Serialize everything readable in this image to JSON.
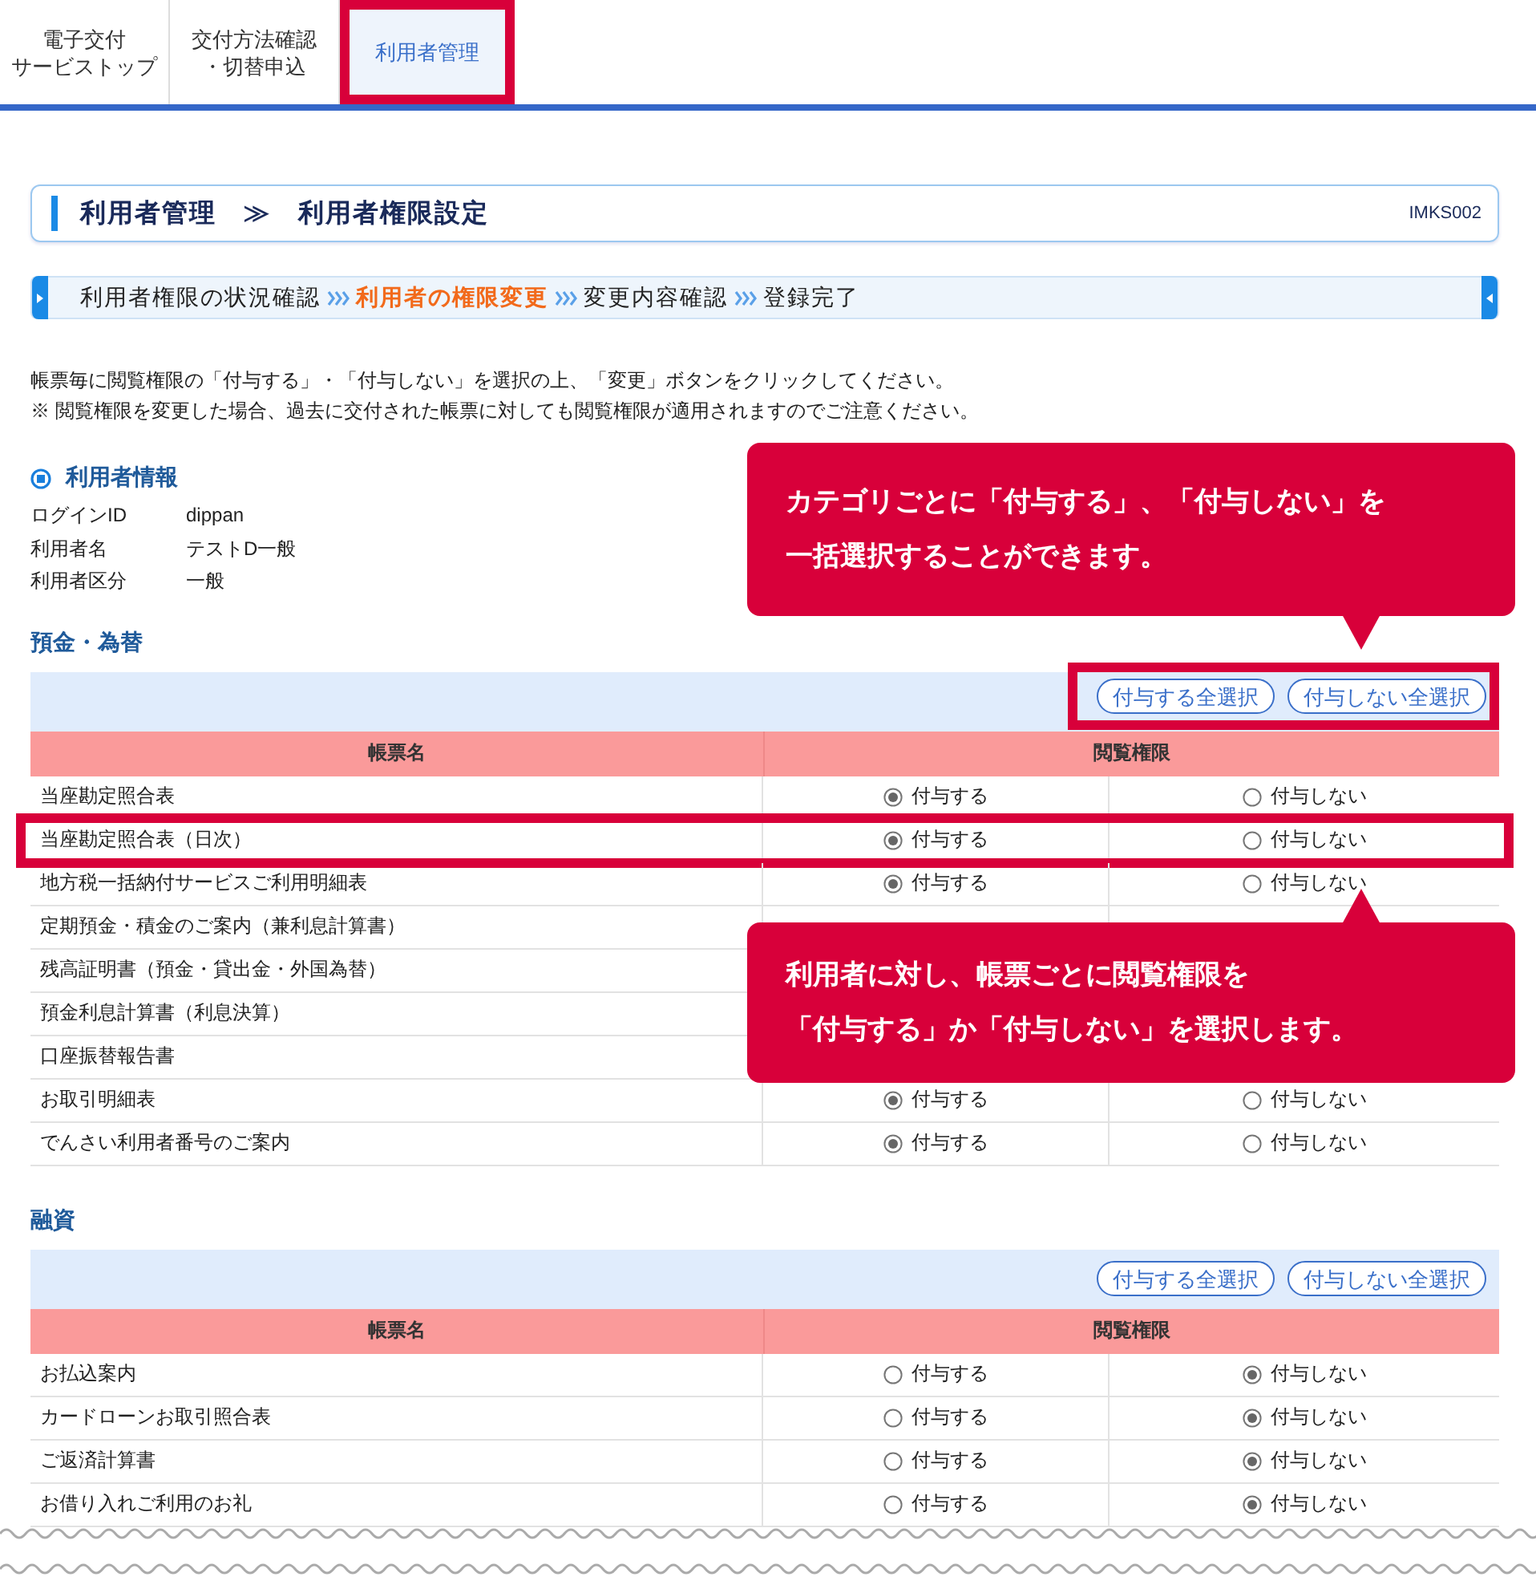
{
  "tabs": [
    {
      "lines": [
        "電子交付",
        "サービストップ"
      ],
      "selected": false,
      "highlighted": false
    },
    {
      "lines": [
        "交付方法確認",
        "・切替申込"
      ],
      "selected": false,
      "highlighted": false
    },
    {
      "lines": [
        "利用者管理"
      ],
      "selected": true,
      "highlighted": true
    }
  ],
  "page_title": {
    "text": "利用者管理　≫　利用者権限設定",
    "screen_id": "IMKS002"
  },
  "steps": [
    {
      "label": "利用者権限の状況確認",
      "current": false
    },
    {
      "label": "利用者の権限変更",
      "current": true
    },
    {
      "label": "変更内容確認",
      "current": false
    },
    {
      "label": "登録完了",
      "current": false
    }
  ],
  "instructions": [
    "帳票毎に閲覧権限の「付与する」・「付与しない」を選択の上、「変更」ボタンをクリックしてください。",
    "※ 閲覧権限を変更した場合、過去に交付された帳票に対しても閲覧権限が適用されますのでご注意ください。"
  ],
  "user_info": {
    "heading": "利用者情報",
    "fields": [
      {
        "label": "ログインID",
        "value": "dippan"
      },
      {
        "label": "利用者名",
        "value": "テストD一般"
      },
      {
        "label": "利用者区分",
        "value": "一般"
      }
    ]
  },
  "sections": [
    {
      "title": "預金・為替",
      "buttons": [
        "付与する全選択",
        "付与しない全選択"
      ],
      "buttons_highlighted": true,
      "columns": [
        "帳票名",
        "閲覧権限"
      ],
      "callouts": [
        {
          "kind": "above",
          "lines": [
            "カテゴリごとに「付与する」、「付与しない」を",
            "一括選択することができます。"
          ]
        },
        {
          "kind": "over_rows",
          "lines": [
            "利用者に対し、帳票ごとに閲覧権限を",
            "「付与する」か「付与しない」を選択します。"
          ]
        }
      ],
      "rows": [
        {
          "name": "当座勘定照合表",
          "highlighted": false,
          "options": [
            {
              "label": "付与する",
              "selected": true
            },
            {
              "label": "付与しない",
              "selected": false
            }
          ]
        },
        {
          "name": "当座勘定照合表（日次）",
          "highlighted": true,
          "options": [
            {
              "label": "付与する",
              "selected": true
            },
            {
              "label": "付与しない",
              "selected": false
            }
          ]
        },
        {
          "name": "地方税一括納付サービスご利用明細表",
          "highlighted": false,
          "options": [
            {
              "label": "付与する",
              "selected": true
            },
            {
              "label": "付与しない",
              "selected": false
            }
          ]
        },
        {
          "name": "定期預金・積金のご案内（兼利息計算書）",
          "highlighted": false
        },
        {
          "name": "残高証明書（預金・貸出金・外国為替）",
          "highlighted": false
        },
        {
          "name": "預金利息計算書（利息決算）",
          "highlighted": false
        },
        {
          "name": "口座振替報告書",
          "highlighted": false
        },
        {
          "name": "お取引明細表",
          "highlighted": false,
          "options": [
            {
              "label": "付与する",
              "selected": true
            },
            {
              "label": "付与しない",
              "selected": false
            }
          ]
        },
        {
          "name": "でんさい利用者番号のご案内",
          "highlighted": false,
          "options": [
            {
              "label": "付与する",
              "selected": true
            },
            {
              "label": "付与しない",
              "selected": false
            }
          ]
        }
      ]
    },
    {
      "title": "融資",
      "buttons": [
        "付与する全選択",
        "付与しない全選択"
      ],
      "buttons_highlighted": false,
      "columns": [
        "帳票名",
        "閲覧権限"
      ],
      "rows": [
        {
          "name": "お払込案内",
          "highlighted": false,
          "options": [
            {
              "label": "付与する",
              "selected": false
            },
            {
              "label": "付与しない",
              "selected": true
            }
          ]
        },
        {
          "name": "カードローンお取引照合表",
          "highlighted": false,
          "options": [
            {
              "label": "付与する",
              "selected": false
            },
            {
              "label": "付与しない",
              "selected": true
            }
          ]
        },
        {
          "name": "ご返済計算書",
          "highlighted": false,
          "options": [
            {
              "label": "付与する",
              "selected": false
            },
            {
              "label": "付与しない",
              "selected": true
            }
          ]
        },
        {
          "name": "お借り入れご利用のお礼",
          "highlighted": false,
          "options": [
            {
              "label": "付与する",
              "selected": false
            },
            {
              "label": "付与しない",
              "selected": true
            }
          ]
        }
      ]
    }
  ]
}
